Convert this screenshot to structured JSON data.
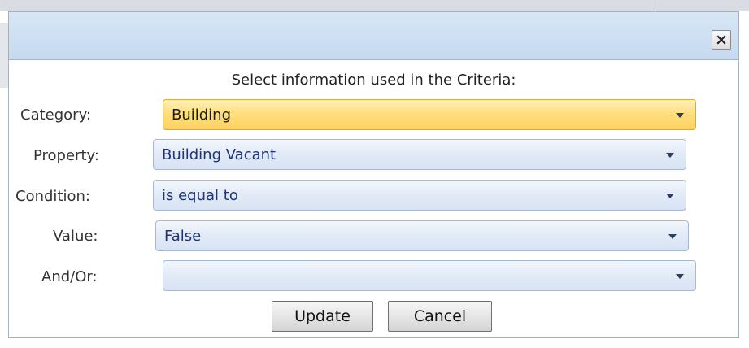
{
  "dialog": {
    "instruction": "Select information used in the Criteria:",
    "close_icon": "close-icon"
  },
  "fields": {
    "category": {
      "label": "Category:",
      "value": "Building"
    },
    "property": {
      "label": "Property:",
      "value": "Building Vacant"
    },
    "condition": {
      "label": "Condition:",
      "value": "is equal to"
    },
    "value": {
      "label": "Value:",
      "value": "False"
    },
    "andor": {
      "label": "And/Or:",
      "value": ""
    }
  },
  "buttons": {
    "update": "Update",
    "cancel": "Cancel"
  },
  "colors": {
    "active_combo": "#ffd161",
    "combo": "#e3ebf7",
    "titlebar": "#c6d9f0"
  }
}
